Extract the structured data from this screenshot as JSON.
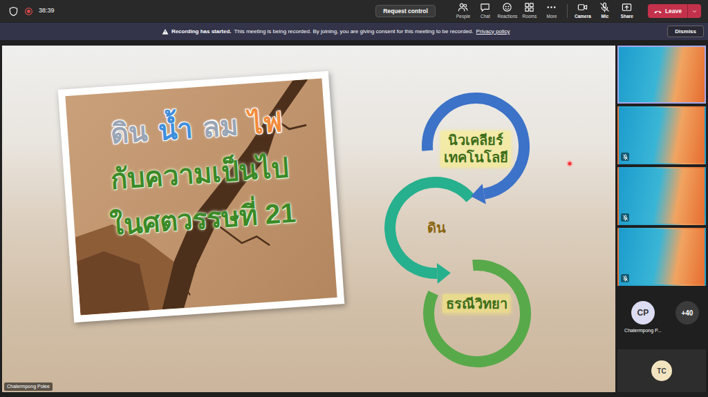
{
  "toolbar": {
    "timer": "38:39",
    "request_control": "Request control",
    "apps": [
      {
        "label": "People"
      },
      {
        "label": "Chat"
      },
      {
        "label": "Reactions"
      },
      {
        "label": "Rooms"
      },
      {
        "label": "More"
      }
    ],
    "devices": [
      {
        "label": "Camera",
        "on": true
      },
      {
        "label": "Mic",
        "on": false
      }
    ],
    "share": "Share",
    "leave": "Leave"
  },
  "banner": {
    "title": "Recording has started.",
    "message": "This meeting is being recorded. By joining, you are giving consent for this meeting to be recorded.",
    "link": "Privacy policy",
    "button": "Dismiss"
  },
  "slide": {
    "title_words": [
      {
        "text": "ดิน",
        "color": "#9aa5b5"
      },
      {
        "text": "น้ำ",
        "color": "#3f8fdc"
      },
      {
        "text": "ลม",
        "color": "#9aa5b5"
      },
      {
        "text": "ไฟ",
        "color": "#f28c3c"
      }
    ],
    "title_lines": [
      "กับความเป็นไป",
      "ในศตวรรษที่ 21"
    ],
    "cycle": [
      {
        "lines": [
          "นิวเคลียร์",
          "เทคโนโลยี"
        ],
        "color": "#3c72c8"
      },
      {
        "lines": [
          "ดิน"
        ],
        "color": "#26b08e"
      },
      {
        "lines": [
          "ธรณีวิทยา"
        ],
        "color": "#58a94a"
      }
    ]
  },
  "presenter": "Chalermpong Polee",
  "tiles": [
    {
      "speaking": true,
      "muted": false
    },
    {
      "speaking": false,
      "muted": true
    },
    {
      "speaking": false,
      "muted": true
    },
    {
      "speaking": false,
      "muted": true
    }
  ],
  "roster": [
    {
      "initials": "CP",
      "name": "Chalermpong P..."
    }
  ],
  "overflow": "+40",
  "self": {
    "initials": "TC"
  }
}
